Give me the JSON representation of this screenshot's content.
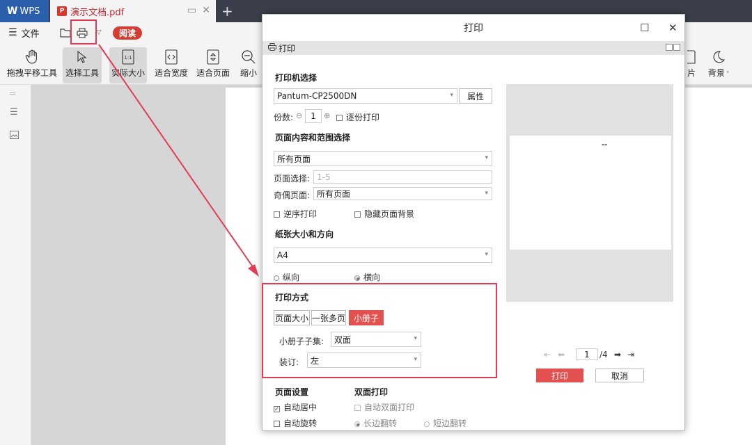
{
  "tabs": {
    "app_label": "WPS",
    "doc_label": "演示文档.pdf"
  },
  "quickbar": {
    "file_label": "文件",
    "read_label": "阅读"
  },
  "ribbon": {
    "tools": [
      {
        "label": "拖拽平移工具"
      },
      {
        "label": "选择工具"
      },
      {
        "label": "实际大小"
      },
      {
        "label": "适合宽度"
      },
      {
        "label": "适合页面"
      },
      {
        "label": "缩小"
      },
      {
        "label": "片"
      },
      {
        "label": "背景"
      }
    ]
  },
  "dialog": {
    "title": "打印",
    "sub_label": "打印",
    "printer_section": "打印机选择",
    "printer_name": "Pantum-CP2500DN",
    "properties_label": "属性",
    "copies_label": "份数:",
    "copies_value": "1",
    "collate_label": "逐份打印",
    "range_section": "页面内容和范围选择",
    "range_value": "所有页面",
    "page_select_label": "页面选择:",
    "page_select_placeholder": "1-5",
    "odd_even_label": "奇偶页面:",
    "odd_even_value": "所有页面",
    "reverse_label": "逆序打印",
    "hide_bg_label": "隐藏页面背景",
    "paper_section": "纸张大小和方向",
    "paper_value": "A4",
    "portrait_label": "纵向",
    "landscape_label": "横向",
    "orientation_selected": "landscape",
    "print_mode_section": "打印方式",
    "mode_buttons": [
      "页面大小",
      "一张多页",
      "小册子"
    ],
    "mode_selected": "小册子",
    "booklet_subset_label": "小册子子集:",
    "booklet_subset_value": "双面",
    "binding_label": "装订:",
    "binding_value": "左",
    "page_setup_section": "页面设置",
    "auto_center_label": "自动居中",
    "auto_center_checked": true,
    "auto_rotate_label": "自动旋转",
    "duplex_section": "双面打印",
    "auto_duplex_label": "自动双面打印",
    "long_edge_label": "长边翻转",
    "short_edge_label": "短边翻转",
    "preview_mark": "--",
    "page_current": "1",
    "page_total": "/4",
    "print_button": "打印",
    "cancel_button": "取消"
  },
  "colors": {
    "accent": "#e35150",
    "annotation": "#e23c54",
    "wps_blue": "#2b5fab"
  }
}
